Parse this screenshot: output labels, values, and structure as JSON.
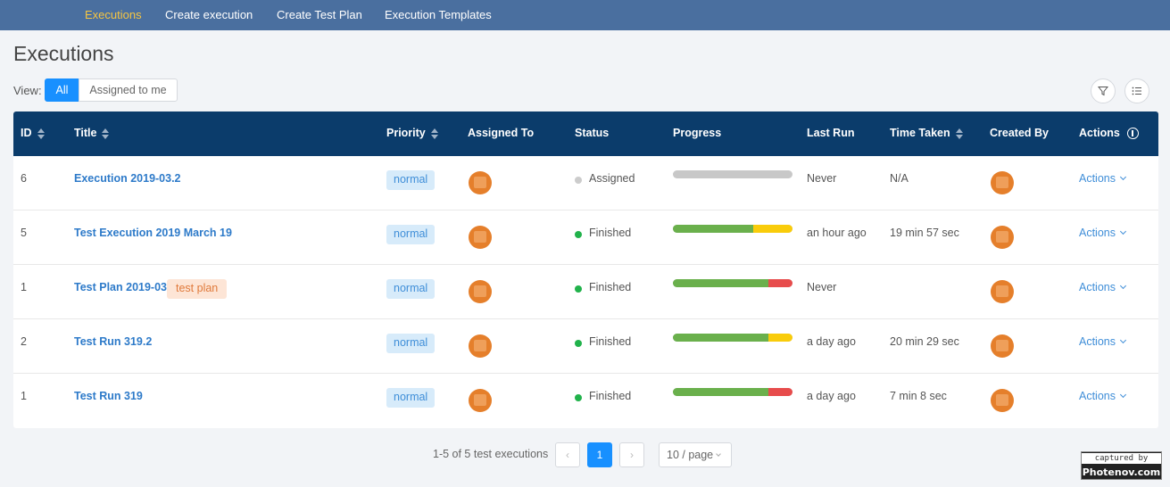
{
  "nav": {
    "items": [
      "Executions",
      "Create execution",
      "Create Test Plan",
      "Execution Templates"
    ]
  },
  "page": {
    "title": "Executions"
  },
  "view": {
    "label": "View:",
    "options": [
      "All",
      "Assigned to me"
    ],
    "selected": "All"
  },
  "toolbar": {
    "filter_icon": "filter-icon",
    "columns_icon": "list-icon"
  },
  "table": {
    "headers": {
      "id": "ID",
      "title": "Title",
      "priority": "Priority",
      "assigned_to": "Assigned To",
      "status": "Status",
      "progress": "Progress",
      "last_run": "Last Run",
      "time_taken": "Time Taken",
      "created_by": "Created By",
      "actions": "Actions"
    },
    "rows": [
      {
        "id": "6",
        "title": "Execution 2019-03.2",
        "tag": "",
        "priority": "normal",
        "status": "Assigned",
        "status_color": "#cccccc",
        "progress": {
          "passed": 0,
          "skipped": 0,
          "failed": 0
        },
        "last_run": "Never",
        "time_taken": "N/A",
        "action": "Actions"
      },
      {
        "id": "5",
        "title": "Test Execution 2019 March 19",
        "tag": "",
        "priority": "normal",
        "status": "Finished",
        "status_color": "#21b24b",
        "progress": {
          "passed": 0.67,
          "skipped": 0.33,
          "failed": 0
        },
        "last_run": "an hour ago",
        "time_taken": "19 min 57 sec",
        "action": "Actions"
      },
      {
        "id": "1",
        "title": "Test Plan 2019-03",
        "tag": "test plan",
        "priority": "normal",
        "status": "Finished",
        "status_color": "#21b24b",
        "progress": {
          "passed": 0.8,
          "skipped": 0,
          "failed": 0.2
        },
        "last_run": "Never",
        "time_taken": "",
        "action": "Actions"
      },
      {
        "id": "2",
        "title": "Test Run 319.2",
        "tag": "",
        "priority": "normal",
        "status": "Finished",
        "status_color": "#21b24b",
        "progress": {
          "passed": 0.8,
          "skipped": 0.2,
          "failed": 0
        },
        "last_run": "a day ago",
        "time_taken": "20 min 29 sec",
        "action": "Actions"
      },
      {
        "id": "1",
        "title": "Test Run 319",
        "tag": "",
        "priority": "normal",
        "status": "Finished",
        "status_color": "#21b24b",
        "progress": {
          "passed": 0.8,
          "skipped": 0,
          "failed": 0.2
        },
        "last_run": "a day ago",
        "time_taken": "7 min 8 sec",
        "action": "Actions"
      }
    ]
  },
  "pagination": {
    "total_text": "1-5 of 5 test executions",
    "current_page": "1",
    "prev": "‹",
    "next": "›",
    "page_size": "10 / page"
  },
  "watermark": {
    "line1": "captured by",
    "line2": "Photenov.com"
  },
  "colors": {
    "nav_bg": "#4a6f9f",
    "nav_active": "#f5c542",
    "header_bg": "#0b3c6b",
    "primary": "#1890ff",
    "link": "#2d7ac9",
    "passed": "#6ab04c",
    "skipped": "#f9cc0b",
    "failed": "#e74c4c",
    "empty": "#c8c8c8",
    "avatar": "#e57f2b"
  }
}
